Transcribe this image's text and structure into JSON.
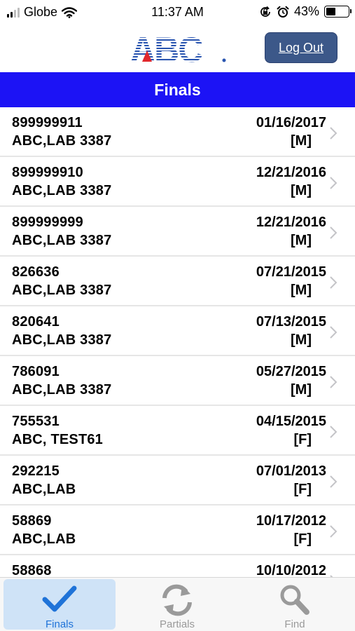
{
  "status_bar": {
    "carrier": "Globe",
    "time": "11:37 AM",
    "battery_percent": "43%",
    "battery_level": 0.43,
    "icons": [
      "signal-icon",
      "wifi-icon",
      "orientation-lock-icon",
      "alarm-icon",
      "battery-icon"
    ]
  },
  "header": {
    "logo_text": "ABC",
    "logout_label": "Log Out",
    "logout_color": "#3c5889"
  },
  "title_bar": {
    "title": "Finals",
    "color": "#1c13f5"
  },
  "results": [
    {
      "id": "899999911",
      "name": "ABC,LAB 3387",
      "date": "01/16/2017",
      "flag": "[M]"
    },
    {
      "id": "899999910",
      "name": "ABC,LAB 3387",
      "date": "12/21/2016",
      "flag": "[M]"
    },
    {
      "id": "899999999",
      "name": "ABC,LAB 3387",
      "date": "12/21/2016",
      "flag": "[M]"
    },
    {
      "id": "826636",
      "name": "ABC,LAB 3387",
      "date": "07/21/2015",
      "flag": "[M]"
    },
    {
      "id": "820641",
      "name": "ABC,LAB 3387",
      "date": "07/13/2015",
      "flag": "[M]"
    },
    {
      "id": "786091",
      "name": "ABC,LAB 3387",
      "date": "05/27/2015",
      "flag": "[M]"
    },
    {
      "id": "755531",
      "name": "ABC, TEST61",
      "date": "04/15/2015",
      "flag": "[F]"
    },
    {
      "id": "292215",
      "name": "ABC,LAB",
      "date": "07/01/2013",
      "flag": "[F]"
    },
    {
      "id": "58869",
      "name": "ABC,LAB",
      "date": "10/17/2012",
      "flag": "[F]"
    },
    {
      "id": "58868",
      "name": "",
      "date": "10/10/2012",
      "flag": ""
    }
  ],
  "tabs": [
    {
      "label": "Finals",
      "icon": "checkmark-icon",
      "active": true
    },
    {
      "label": "Partials",
      "icon": "refresh-icon",
      "active": false
    },
    {
      "label": "Find",
      "icon": "search-icon",
      "active": false
    }
  ],
  "colors": {
    "tab_active": "#1f73d8",
    "tab_inactive": "#9a9a9a"
  }
}
